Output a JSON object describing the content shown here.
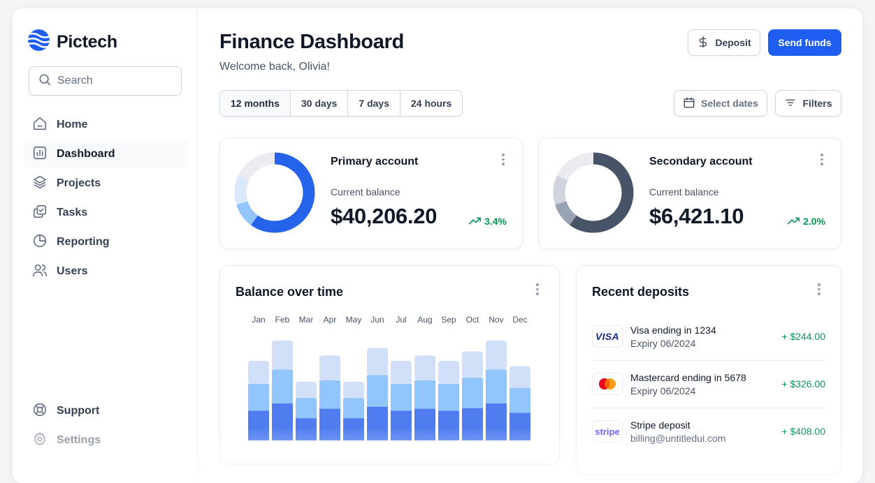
{
  "app": {
    "name": "Pictech"
  },
  "search": {
    "placeholder": "Search"
  },
  "nav": {
    "items": [
      {
        "label": "Home",
        "icon": "home-icon"
      },
      {
        "label": "Dashboard",
        "icon": "bar-chart-icon",
        "active": true
      },
      {
        "label": "Projects",
        "icon": "layers-icon"
      },
      {
        "label": "Tasks",
        "icon": "check-square-icon"
      },
      {
        "label": "Reporting",
        "icon": "pie-chart-icon"
      },
      {
        "label": "Users",
        "icon": "users-icon"
      }
    ],
    "footer": [
      {
        "label": "Support",
        "icon": "life-buoy-icon"
      },
      {
        "label": "Settings",
        "icon": "gear-icon"
      }
    ]
  },
  "header": {
    "title": "Finance Dashboard",
    "subtitle": "Welcome back, Olivia!",
    "deposit_label": "Deposit",
    "send_label": "Send funds"
  },
  "filters": {
    "ranges": [
      "12 months",
      "30 days",
      "7 days",
      "24 hours"
    ],
    "active_range": "12 months",
    "select_dates_label": "Select dates",
    "filters_label": "Filters"
  },
  "accounts": [
    {
      "name": "Primary account",
      "balance_label": "Current balance",
      "balance": "$40,206.20",
      "change": "3.4%",
      "donut": {
        "segments": [
          0.6,
          0.1,
          0.12,
          0.18
        ],
        "colors": [
          "#2563eb",
          "#93c5fd",
          "#dbe7fb",
          "#eaecf0"
        ]
      }
    },
    {
      "name": "Secondary account",
      "balance_label": "Current balance",
      "balance": "$6,421.10",
      "change": "2.0%",
      "donut": {
        "segments": [
          0.6,
          0.1,
          0.12,
          0.18
        ],
        "colors": [
          "#475467",
          "#98a2b3",
          "#d0d5dd",
          "#eaecf0"
        ]
      }
    }
  ],
  "balance_chart": {
    "title": "Balance over time"
  },
  "chart_data": {
    "type": "bar",
    "stacked": true,
    "categories": [
      "Jan",
      "Feb",
      "Mar",
      "Apr",
      "May",
      "Jun",
      "Jul",
      "Aug",
      "Sep",
      "Oct",
      "Nov",
      "Dec"
    ],
    "series": [
      {
        "values": [
          44,
          55,
          33,
          47,
          33,
          50,
          44,
          47,
          44,
          48,
          55,
          41
        ],
        "color": "#4f7df0"
      },
      {
        "values": [
          40,
          50,
          30,
          42,
          30,
          47,
          40,
          42,
          40,
          45,
          50,
          37
        ],
        "color": "#93c5fd"
      },
      {
        "values": [
          34,
          43,
          24,
          37,
          24,
          40,
          34,
          37,
          34,
          39,
          43,
          32
        ],
        "color": "#d1e0f8"
      }
    ],
    "ylim": [
      0,
      150
    ],
    "grid": false,
    "legend": "none"
  },
  "deposits": {
    "title": "Recent deposits",
    "items": [
      {
        "logo": "visa-logo",
        "title": "Visa ending in 1234",
        "subtitle": "Expiry 06/2024",
        "amount": "+ $244.00"
      },
      {
        "logo": "mastercard-logo",
        "title": "Mastercard ending in 5678",
        "subtitle": "Expiry 06/2024",
        "amount": "+ $326.00"
      },
      {
        "logo": "stripe-logo",
        "title": "Stripe deposit",
        "subtitle": "billing@untitledui.com",
        "amount": "+ $408.00"
      }
    ],
    "logo_text": {
      "visa": "VISA",
      "stripe": "stripe"
    }
  },
  "colors": {
    "accent": "#1f5ef0",
    "positive": "#079455",
    "text": "#101828"
  }
}
